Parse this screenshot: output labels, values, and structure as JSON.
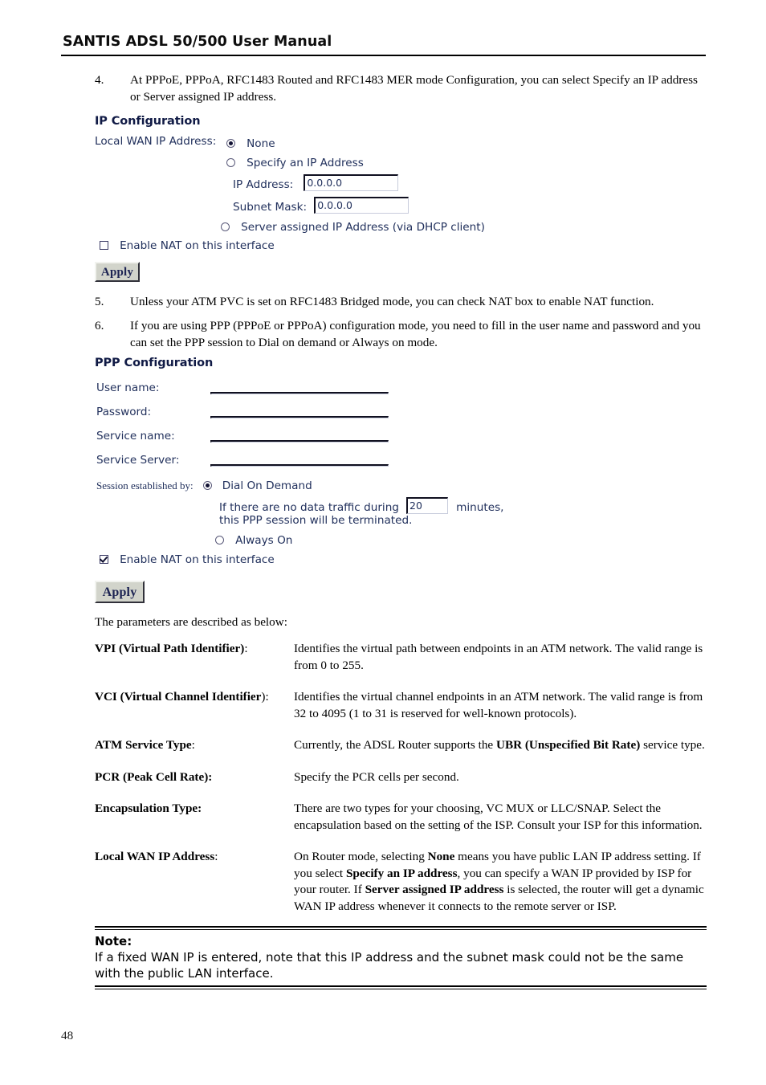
{
  "header": {
    "title": "SANTIS ADSL 50/500 User Manual"
  },
  "steps": [
    {
      "number": "4.",
      "text": "At PPPoE, PPPoA, RFC1483 Routed and RFC1483 MER mode Configuration, you can select Specify an IP address or Server assigned IP address."
    },
    {
      "number": "5.",
      "text": "Unless your ATM PVC is set on RFC1483 Bridged mode, you can check NAT box to enable NAT function."
    },
    {
      "number": "6.",
      "text": "If you are using PPP (PPPoE or PPPoA) configuration mode, you need to fill in the user name and password and you can set the PPP session to Dial on demand or Always on mode."
    }
  ],
  "ip_config": {
    "title": "IP Configuration",
    "local_wan_label": "Local WAN IP Address:",
    "option_none": "None",
    "option_specify": "Specify an IP Address",
    "option_server": "Server assigned IP Address (via DHCP client)",
    "selected_option": "None",
    "ip_address_label": "IP Address:",
    "ip_address_value": "0.0.0.0",
    "subnet_mask_label": "Subnet Mask:",
    "subnet_mask_value": "0.0.0.0",
    "nat_label": "Enable NAT on this interface",
    "nat_checked": false,
    "apply_label": "Apply"
  },
  "ppp_config": {
    "title": "PPP Configuration",
    "fields": [
      {
        "label": "User name:",
        "value": ""
      },
      {
        "label": "Password:",
        "value": ""
      },
      {
        "label": "Service name:",
        "value": ""
      },
      {
        "label": "Service Server:",
        "value": ""
      }
    ],
    "session_label": "Session established by:",
    "option_dial": "Dial On Demand",
    "option_always": "Always On",
    "selected_session": "Dial On Demand",
    "idle_prefix": "If there are no data traffic during",
    "idle_value": "20",
    "idle_suffix": "minutes,",
    "idle_line2": "this PPP session will be terminated.",
    "nat_label": "Enable NAT on this interface",
    "nat_checked": true,
    "apply_label": "Apply"
  },
  "parameters": {
    "intro": "The parameters are described as below:",
    "rows": [
      {
        "term_bold": "VPI (Virtual Path Identifier)",
        "term_tail": ":",
        "desc": "Identifies the virtual path between endpoints in an ATM network. The valid range is from 0 to 255."
      },
      {
        "term_bold": "VCI (Virtual Channel Identifier",
        "term_tail": "):",
        "desc": "Identifies the virtual channel endpoints in an ATM network. The valid range is from 32 to 4095 (1 to 31 is reserved for well-known protocols)."
      },
      {
        "term_bold": "ATM Service Type",
        "term_tail": ":",
        "desc_pre": "Currently, the ADSL Router supports the ",
        "desc_bold": "UBR (Unspecified Bit Rate)",
        "desc_post": " service type."
      },
      {
        "term_bold": "PCR (Peak Cell Rate):",
        "term_tail": "",
        "desc": "Specify the PCR cells per second."
      },
      {
        "term_bold": "Encapsulation Type:",
        "term_tail": "",
        "desc": "There are two types for your choosing, VC MUX or LLC/SNAP. Select the encapsulation based on the setting of the ISP. Consult your ISP for this information."
      },
      {
        "term_bold": "Local WAN IP Address",
        "term_tail": ":",
        "desc_a": "On Router mode, selecting ",
        "desc_b1": "None",
        "desc_c": " means you have public LAN IP address setting. If you select ",
        "desc_b2": "Specify an IP address",
        "desc_d": ", you can specify a WAN IP provided by ISP for your router. If ",
        "desc_b3": "Server assigned IP address",
        "desc_e": " is selected, the router will get a dynamic WAN IP address whenever it connects to the remote server or ISP."
      }
    ]
  },
  "note": {
    "title": "Note:",
    "text": "If a fixed WAN IP is entered, note that this IP address and the subnet mask could not be the same with the public LAN interface."
  },
  "footer": {
    "page_number": "48"
  }
}
